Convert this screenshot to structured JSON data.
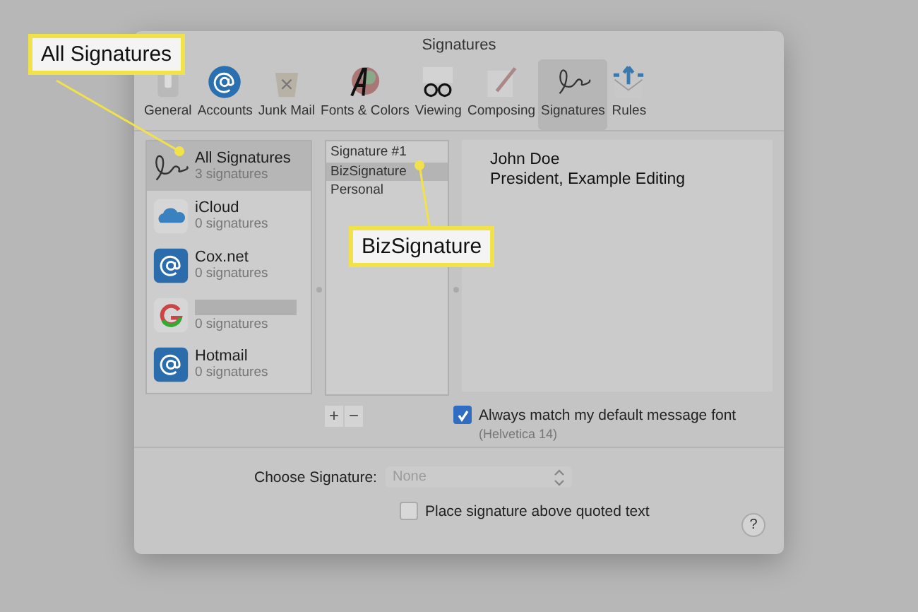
{
  "window": {
    "title": "Signatures"
  },
  "tabs": [
    {
      "label": "General",
      "selected": false
    },
    {
      "label": "Accounts",
      "selected": false
    },
    {
      "label": "Junk Mail",
      "selected": false
    },
    {
      "label": "Fonts & Colors",
      "selected": false
    },
    {
      "label": "Viewing",
      "selected": false
    },
    {
      "label": "Composing",
      "selected": false
    },
    {
      "label": "Signatures",
      "selected": true
    },
    {
      "label": "Rules",
      "selected": false
    }
  ],
  "accounts": [
    {
      "kind": "all",
      "name": "All Signatures",
      "count": "3 signatures",
      "selected": true
    },
    {
      "kind": "icloud",
      "name": "iCloud",
      "count": "0 signatures",
      "selected": false
    },
    {
      "kind": "mail",
      "name": "Cox.net",
      "count": "0 signatures",
      "selected": false
    },
    {
      "kind": "google",
      "count": "0 signatures",
      "selected": false
    },
    {
      "kind": "mail",
      "name": "Hotmail",
      "count": "0 signatures",
      "selected": false
    }
  ],
  "signatures": [
    {
      "name": "Signature #1",
      "selected": false
    },
    {
      "name": "BizSignature",
      "selected": true
    },
    {
      "name": "Personal",
      "selected": false
    }
  ],
  "editor": {
    "lines": [
      "John Doe",
      "President, Example Editing"
    ]
  },
  "add_button": "+",
  "remove_button": "−",
  "match_font": {
    "label": "Always match my default message font",
    "checked": true,
    "note": "(Helvetica 14)"
  },
  "choose_signature": {
    "label": "Choose Signature:",
    "value": "None",
    "disabled": true
  },
  "place_above": {
    "label": "Place signature above quoted text",
    "checked": false
  },
  "help_button": "?",
  "callouts": [
    {
      "text": "All Signatures"
    },
    {
      "text": "BizSignature"
    }
  ]
}
